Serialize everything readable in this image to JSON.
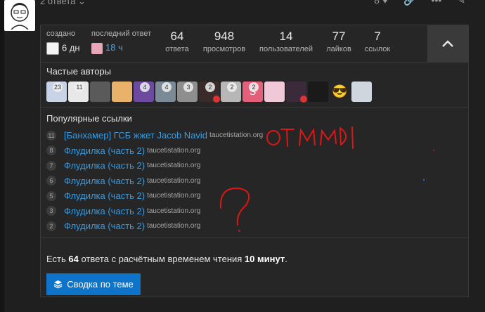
{
  "topic": {
    "replies_label": "2 ответа",
    "likes_count": "8"
  },
  "stats": {
    "created_label": "создано",
    "created_value": "6 дн",
    "last_reply_label": "последний ответ",
    "last_reply_value": "18 ч",
    "items": [
      {
        "value": "64",
        "label": "ответа"
      },
      {
        "value": "948",
        "label": "просмотров"
      },
      {
        "value": "14",
        "label": "пользователей"
      },
      {
        "value": "77",
        "label": "лайков"
      },
      {
        "value": "7",
        "label": "ссылок"
      }
    ]
  },
  "authors": {
    "title": "Частые авторы",
    "counts": [
      "23",
      "11",
      "",
      "",
      "4",
      "4",
      "3",
      "2",
      "2",
      "2",
      "",
      "",
      "",
      "",
      ""
    ]
  },
  "popular_links": {
    "title": "Популярные ссылки",
    "items": [
      {
        "count": "11",
        "title": "[Банхамер] ГСБ жжет Jacob Navid",
        "domain": "taucetistation.org"
      },
      {
        "count": "8",
        "title": "Флудилка (часть 2)",
        "domain": "taucetistation.org"
      },
      {
        "count": "7",
        "title": "Флудилка (часть 2)",
        "domain": "taucetistation.org"
      },
      {
        "count": "6",
        "title": "Флудилка (часть 2)",
        "domain": "taucetistation.org"
      },
      {
        "count": "5",
        "title": "Флудилка (часть 2)",
        "domain": "taucetistation.org"
      },
      {
        "count": "3",
        "title": "Флудилка (часть 2)",
        "domain": "taucetistation.org"
      },
      {
        "count": "2",
        "title": "Флудилка (часть 2)",
        "domain": "taucetistation.org"
      }
    ]
  },
  "summary": {
    "prefix": "Есть ",
    "replies": "64",
    "middle": " ответа с расчётным временем чтения ",
    "time": "10 минут",
    "suffix": "."
  },
  "summary_button": {
    "label": "Сводка по теме"
  },
  "annotation": {
    "text": "от MMDI",
    "mark": "?"
  },
  "colors": {
    "accent": "#0d74c9",
    "link": "#3a9be0",
    "scribble": "#e01515"
  }
}
